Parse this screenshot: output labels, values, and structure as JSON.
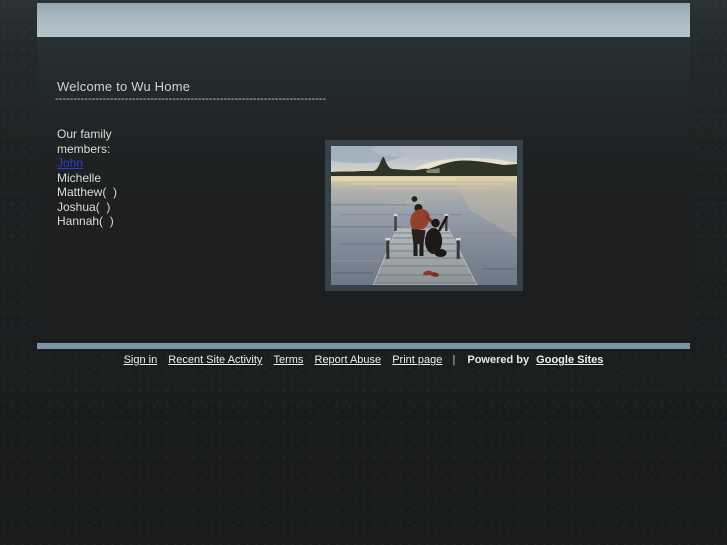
{
  "header": {
    "banner": ""
  },
  "page": {
    "title": "Welcome to Wu Home",
    "divider": "--------------------------------------------------------------------------"
  },
  "family": {
    "intro": "Our family\nmembers:",
    "members": [
      {
        "label": "John",
        "is_link": true
      },
      {
        "label": "Michelle",
        "is_link": false
      },
      {
        "label": "Matthew(  )",
        "is_link": false
      },
      {
        "label": "Joshua(  )",
        "is_link": false
      },
      {
        "label": "Hannah(  )",
        "is_link": false
      }
    ]
  },
  "photo": {
    "description": "sunset-lake-dock-with-family"
  },
  "footer": {
    "links": [
      "Sign in",
      "Recent Site Activity",
      "Terms",
      "Report Abuse",
      "Print page"
    ],
    "separator": "|",
    "powered_by_label": "Powered by",
    "powered_by_link": "Google Sites"
  },
  "colors": {
    "header_band": "#a9bac2",
    "footer_bar": "#7b97a2",
    "link_blue": "#2e3bd3",
    "page_background": "#1a1c1d",
    "body_text": "#dcdcdc"
  }
}
